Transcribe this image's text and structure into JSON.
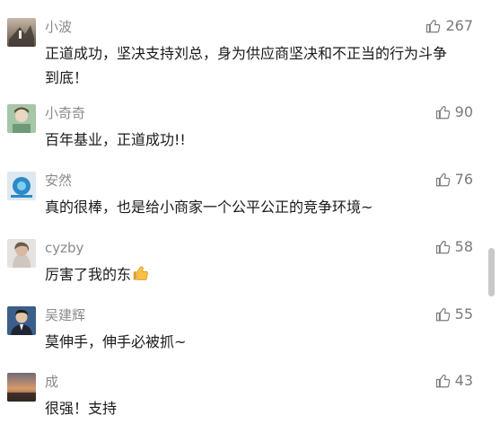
{
  "colors": {
    "background": "#ffffff",
    "name_text": "#8a8a8a",
    "comment_text": "#1a1a1a",
    "like_text": "#7a7a7a",
    "scrollbar": "#c8c8c8"
  },
  "comments": [
    {
      "name": "小波",
      "text": "正道成功，坚决支持刘总，身为供应商坚决和不正当的行为斗争到底！",
      "likes": "267",
      "avatar_icon": "photo-avatar-icon"
    },
    {
      "name": "小奇奇",
      "text": "百年基业，正道成功!!",
      "likes": "90",
      "avatar_icon": "photo-avatar-icon"
    },
    {
      "name": "安然",
      "text": "真的很棒，也是给小商家一个公平公正的竞争环境~",
      "likes": "76",
      "avatar_icon": "photo-avatar-icon"
    },
    {
      "name": "cyzby",
      "text": "厉害了我的东",
      "likes": "58",
      "avatar_icon": "photo-avatar-icon",
      "emoji": "thumbs-up-emoji-icon"
    },
    {
      "name": "吴建辉",
      "text": "莫伸手，伸手必被抓~",
      "likes": "55",
      "avatar_icon": "photo-avatar-icon"
    },
    {
      "name": "成",
      "text": "很强！支持",
      "likes": "43",
      "avatar_icon": "photo-avatar-icon"
    }
  ],
  "like_icon": "thumbs-up-outline-icon"
}
